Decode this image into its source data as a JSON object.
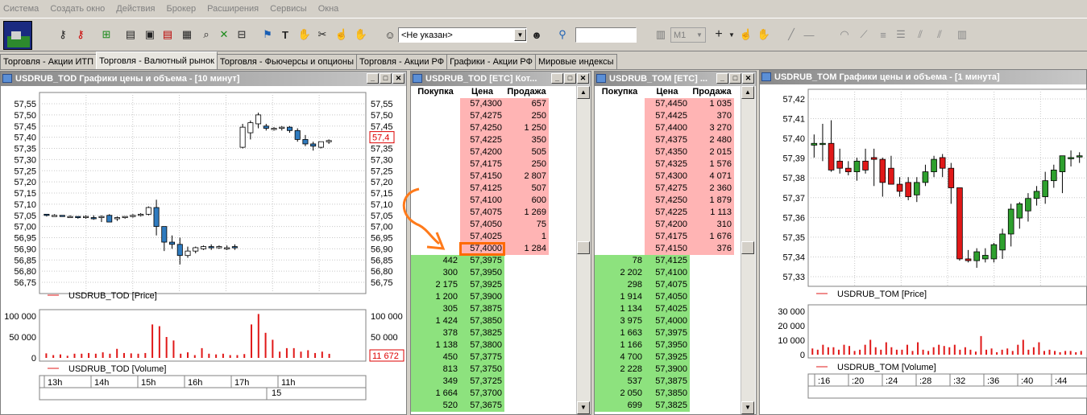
{
  "menu": [
    "Система",
    "Создать окно",
    "Действия",
    "Брокер",
    "Расширения",
    "Сервисы",
    "Окна"
  ],
  "toolbar": {
    "account_select": "<Не указан>",
    "timeframe": "M1"
  },
  "tabs": [
    "Торговля - Акции ИТП",
    "Торговля - Валютный рынок",
    "Торговля - Фьючерсы и опционы",
    "Торговля - Акции РФ",
    "Графики - Акции РФ",
    "Мировые индексы"
  ],
  "active_tab": 1,
  "chart_tod": {
    "title": "USDRUB_TOD Графики цены и объема - [10 минут]",
    "price_legend": "USDRUB_TOD [Price]",
    "volume_legend": "USDRUB_TOD [Volume]",
    "price_ticks": [
      "57,55",
      "57,50",
      "57,45",
      "57,40",
      "57,35",
      "57,30",
      "57,25",
      "57,20",
      "57,15",
      "57,10",
      "57,05",
      "57,00",
      "56,95",
      "56,90",
      "56,85",
      "56,80",
      "56,75"
    ],
    "right_price_label": "57,4",
    "volume_ticks": [
      "100 000",
      "50 000",
      "0"
    ],
    "right_volume_label": "11 672",
    "time_ticks": [
      "13h",
      "14h",
      "15h",
      "16h",
      "17h",
      "11h"
    ],
    "date_label": "15"
  },
  "chart_tom": {
    "title": "USDRUB_TOM Графики цены и объема - [1 минута]",
    "price_legend": "USDRUB_TOM [Price]",
    "volume_legend": "USDRUB_TOM [Volume]",
    "price_ticks": [
      "57,42",
      "57,41",
      "57,40",
      "57,39",
      "57,38",
      "57,37",
      "57,36",
      "57,35",
      "57,34",
      "57,33"
    ],
    "volume_ticks": [
      "30 000",
      "20 000",
      "10 000",
      "0"
    ],
    "time_ticks": [
      ":16",
      ":20",
      ":24",
      ":28",
      ":32",
      ":36",
      ":40",
      ":44"
    ]
  },
  "ob_tod": {
    "title": "USDRUB_TOD [ETC] Кот...",
    "headers": [
      "Покупка",
      "Цена",
      "Продажа"
    ],
    "asks": [
      [
        "57,4300",
        "657"
      ],
      [
        "57,4275",
        "250"
      ],
      [
        "57,4250",
        "1 250"
      ],
      [
        "57,4225",
        "350"
      ],
      [
        "57,4200",
        "505"
      ],
      [
        "57,4175",
        "250"
      ],
      [
        "57,4150",
        "2 807"
      ],
      [
        "57,4125",
        "507"
      ],
      [
        "57,4100",
        "600"
      ],
      [
        "57,4075",
        "1 269"
      ],
      [
        "57,4050",
        "75"
      ],
      [
        "57,4025",
        "1"
      ],
      [
        "57,4000",
        "1 284"
      ]
    ],
    "bids": [
      [
        "442",
        "57,3975"
      ],
      [
        "300",
        "57,3950"
      ],
      [
        "2 175",
        "57,3925"
      ],
      [
        "1 200",
        "57,3900"
      ],
      [
        "305",
        "57,3875"
      ],
      [
        "1 424",
        "57,3850"
      ],
      [
        "378",
        "57,3825"
      ],
      [
        "1 138",
        "57,3800"
      ],
      [
        "450",
        "57,3775"
      ],
      [
        "813",
        "57,3750"
      ],
      [
        "349",
        "57,3725"
      ],
      [
        "1 664",
        "57,3700"
      ],
      [
        "520",
        "57,3675"
      ]
    ]
  },
  "ob_tom": {
    "title": "USDRUB_TOM [ETC] ...",
    "headers": [
      "Покупка",
      "Цена",
      "Продажа"
    ],
    "asks": [
      [
        "57,4450",
        "1 035"
      ],
      [
        "57,4425",
        "370"
      ],
      [
        "57,4400",
        "3 270"
      ],
      [
        "57,4375",
        "2 480"
      ],
      [
        "57,4350",
        "2 015"
      ],
      [
        "57,4325",
        "1 576"
      ],
      [
        "57,4300",
        "4 071"
      ],
      [
        "57,4275",
        "2 360"
      ],
      [
        "57,4250",
        "1 879"
      ],
      [
        "57,4225",
        "1 113"
      ],
      [
        "57,4200",
        "310"
      ],
      [
        "57,4175",
        "1 676"
      ],
      [
        "57,4150",
        "376"
      ]
    ],
    "bids": [
      [
        "78",
        "57,4125"
      ],
      [
        "2 202",
        "57,4100"
      ],
      [
        "298",
        "57,4075"
      ],
      [
        "1 914",
        "57,4050"
      ],
      [
        "1 134",
        "57,4025"
      ],
      [
        "3 975",
        "57,4000"
      ],
      [
        "1 663",
        "57,3975"
      ],
      [
        "1 166",
        "57,3950"
      ],
      [
        "4 700",
        "57,3925"
      ],
      [
        "2 228",
        "57,3900"
      ],
      [
        "537",
        "57,3875"
      ],
      [
        "2 050",
        "57,3850"
      ],
      [
        "699",
        "57,3825"
      ]
    ]
  },
  "colors": {
    "ask_bg": "#ffb4b4",
    "bid_bg": "#8de27e",
    "candle_up": "#ffffff",
    "candle_down_tod": "#2f7bbf",
    "candle_up_tom": "#2ea02e",
    "candle_down_tom": "#e01818",
    "volume": "#e01818",
    "highlight": "#ff6a00"
  },
  "chart_data": [
    {
      "type": "candlestick",
      "name": "USDRUB_TOD",
      "ylim": [
        56.75,
        57.55
      ],
      "candles": [
        [
          57.055,
          57.055,
          57.045,
          57.05
        ],
        [
          57.05,
          57.055,
          57.045,
          57.05
        ],
        [
          57.05,
          57.05,
          57.045,
          57.045
        ],
        [
          57.045,
          57.05,
          57.04,
          57.045
        ],
        [
          57.045,
          57.045,
          57.035,
          57.04
        ],
        [
          57.04,
          57.05,
          57.035,
          57.045
        ],
        [
          57.04,
          57.05,
          57.03,
          57.035
        ],
        [
          57.045,
          57.05,
          57.02,
          57.045
        ],
        [
          57.05,
          57.055,
          57.035,
          57.02
        ],
        [
          57.035,
          57.045,
          57.025,
          57.04
        ],
        [
          57.04,
          57.045,
          57.035,
          57.045
        ],
        [
          57.045,
          57.055,
          57.04,
          57.05
        ],
        [
          57.05,
          57.06,
          57.045,
          57.055
        ],
        [
          57.055,
          57.09,
          57.05,
          57.085
        ],
        [
          57.085,
          57.12,
          56.96,
          57.0
        ],
        [
          57.0,
          57.0,
          56.89,
          56.93
        ],
        [
          56.93,
          56.96,
          56.9,
          56.92
        ],
        [
          56.92,
          56.95,
          56.83,
          56.87
        ],
        [
          56.87,
          56.91,
          56.86,
          56.89
        ],
        [
          56.89,
          56.91,
          56.88,
          56.905
        ],
        [
          56.9,
          56.915,
          56.895,
          56.91
        ],
        [
          56.91,
          56.92,
          56.895,
          56.905
        ],
        [
          56.905,
          56.915,
          56.9,
          56.91
        ],
        [
          56.905,
          56.915,
          56.895,
          56.905
        ],
        [
          56.91,
          56.92,
          56.895,
          56.905
        ],
        [
          57.355,
          57.46,
          57.35,
          57.445
        ],
        [
          57.42,
          57.475,
          57.39,
          57.465
        ],
        [
          57.46,
          57.51,
          57.44,
          57.5
        ],
        [
          57.45,
          57.46,
          57.43,
          57.44
        ],
        [
          57.44,
          57.445,
          57.43,
          57.44
        ],
        [
          57.44,
          57.45,
          57.43,
          57.445
        ],
        [
          57.445,
          57.45,
          57.42,
          57.43
        ],
        [
          57.43,
          57.44,
          57.38,
          57.39
        ],
        [
          57.39,
          57.41,
          57.36,
          57.37
        ],
        [
          57.37,
          57.38,
          57.34,
          57.36
        ],
        [
          57.355,
          57.38,
          57.35,
          57.38
        ],
        [
          57.38,
          57.39,
          57.37,
          57.385
        ]
      ],
      "volumes": [
        13000,
        8000,
        10000,
        6000,
        12000,
        12000,
        14000,
        12000,
        16000,
        12000,
        26000,
        14000,
        13000,
        12000,
        14000,
        96000,
        91000,
        60000,
        50000,
        12000,
        16000,
        8000,
        28000,
        12000,
        10000,
        12000,
        8000,
        8000,
        11000,
        96000,
        126000,
        72000,
        52000,
        18000,
        28000,
        28000,
        18000,
        22000,
        14000,
        18000,
        11672
      ]
    },
    {
      "type": "candlestick",
      "name": "USDRUB_TOM",
      "ylim": [
        57.325,
        57.425
      ],
      "candles": [
        [
          57.399,
          57.405,
          57.392,
          57.4
        ],
        [
          57.4,
          57.411,
          57.39,
          57.4
        ],
        [
          57.4,
          57.413,
          57.384,
          57.385
        ],
        [
          57.39,
          57.397,
          57.383,
          57.386
        ],
        [
          57.386,
          57.39,
          57.382,
          57.384
        ],
        [
          57.384,
          57.392,
          57.379,
          57.39
        ],
        [
          57.39,
          57.397,
          57.383,
          57.385
        ],
        [
          57.392,
          57.397,
          57.376,
          57.391
        ],
        [
          57.391,
          57.392,
          57.37,
          57.378
        ],
        [
          57.386,
          57.393,
          57.377,
          57.377
        ],
        [
          57.377,
          57.381,
          57.37,
          57.373
        ],
        [
          57.378,
          57.381,
          57.368,
          57.37
        ],
        [
          57.371,
          57.381,
          57.367,
          57.378
        ],
        [
          57.378,
          57.388,
          57.376,
          57.384
        ],
        [
          57.384,
          57.393,
          57.381,
          57.391
        ],
        [
          57.392,
          57.394,
          57.381,
          57.386
        ],
        [
          57.386,
          57.389,
          57.366,
          57.375
        ],
        [
          57.375,
          57.375,
          57.334,
          57.335
        ],
        [
          57.335,
          57.34,
          57.333,
          57.334
        ],
        [
          57.334,
          57.341,
          57.33,
          57.339
        ],
        [
          57.335,
          57.341,
          57.333,
          57.337
        ],
        [
          57.335,
          57.344,
          57.333,
          57.343
        ],
        [
          57.34,
          57.352,
          57.335,
          57.349
        ],
        [
          57.349,
          57.366,
          57.342,
          57.363
        ],
        [
          57.358,
          57.367,
          57.352,
          57.366
        ],
        [
          57.362,
          57.372,
          57.356,
          57.369
        ],
        [
          57.369,
          57.376,
          57.365,
          57.373
        ],
        [
          57.37,
          57.384,
          57.366,
          57.379
        ],
        [
          57.379,
          57.388,
          57.375,
          57.385
        ],
        [
          57.384,
          57.393,
          57.372,
          57.393
        ],
        [
          57.392,
          57.396,
          57.387,
          57.392
        ],
        [
          57.393,
          57.395,
          57.389,
          57.393
        ]
      ],
      "volumes": [
        5000,
        4000,
        8000,
        6000,
        6000,
        4000,
        8000,
        7000,
        3000,
        4000,
        8000,
        12000,
        6000,
        4000,
        10000,
        6000,
        4000,
        4000,
        8000,
        3000,
        10000,
        4000,
        3000,
        6000,
        8000,
        7000,
        6000,
        8000,
        4000,
        6000,
        4000,
        2500,
        15000,
        4000,
        5000,
        2000,
        4000,
        5000,
        3000,
        8000,
        12000,
        4000,
        6000,
        10000,
        3000,
        4000,
        3000,
        2000,
        3000,
        3000,
        2000,
        3000
      ]
    }
  ]
}
